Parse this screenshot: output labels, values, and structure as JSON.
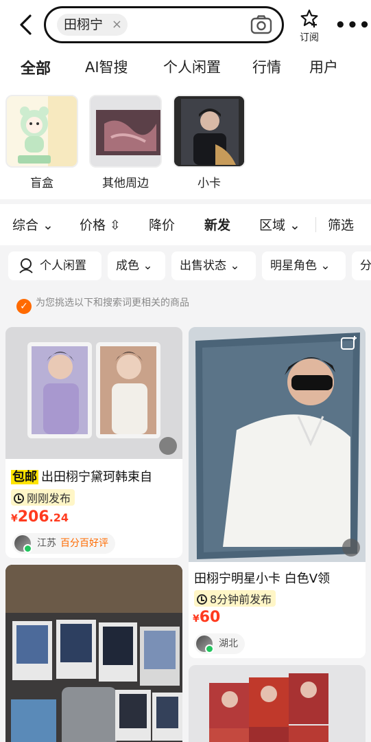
{
  "search": {
    "keyword": "田栩宁",
    "clear": "×"
  },
  "header": {
    "subscribe_label": "订阅",
    "more": "•••"
  },
  "tabs": [
    {
      "label": "全部",
      "active": true
    },
    {
      "label": "AI智搜"
    },
    {
      "label": "个人闲置"
    },
    {
      "label": "行情"
    },
    {
      "label": "用户"
    }
  ],
  "categories": [
    {
      "label": "盲盒"
    },
    {
      "label": "其他周边"
    },
    {
      "label": "小卡"
    }
  ],
  "filters": {
    "sort": "综合",
    "price": "价格",
    "drop": "降价",
    "newest": "新发",
    "region": "区域",
    "screen": "筛选"
  },
  "pills": [
    "个人闲置",
    "成色",
    "出售状态",
    "明星角色",
    "分"
  ],
  "tip": "为您挑选以下和搜索词更相关的商品",
  "products": [
    {
      "free_ship": "包邮",
      "title": "出田栩宁黛珂韩束自",
      "time": "刚刚发布",
      "price_symbol": "¥",
      "price_int": "206",
      "price_dec": ".24",
      "location": "江苏",
      "badge": "百分百好评"
    },
    {
      "title": "田栩宁明星小卡 白色V领",
      "time": "8分钟前发布",
      "price_symbol": "¥",
      "price_int": "60",
      "location": "湖北"
    }
  ],
  "colors": {
    "accent_yellow": "#ffe400",
    "price_red": "#ff3b1f",
    "orange": "#ff6a00"
  }
}
